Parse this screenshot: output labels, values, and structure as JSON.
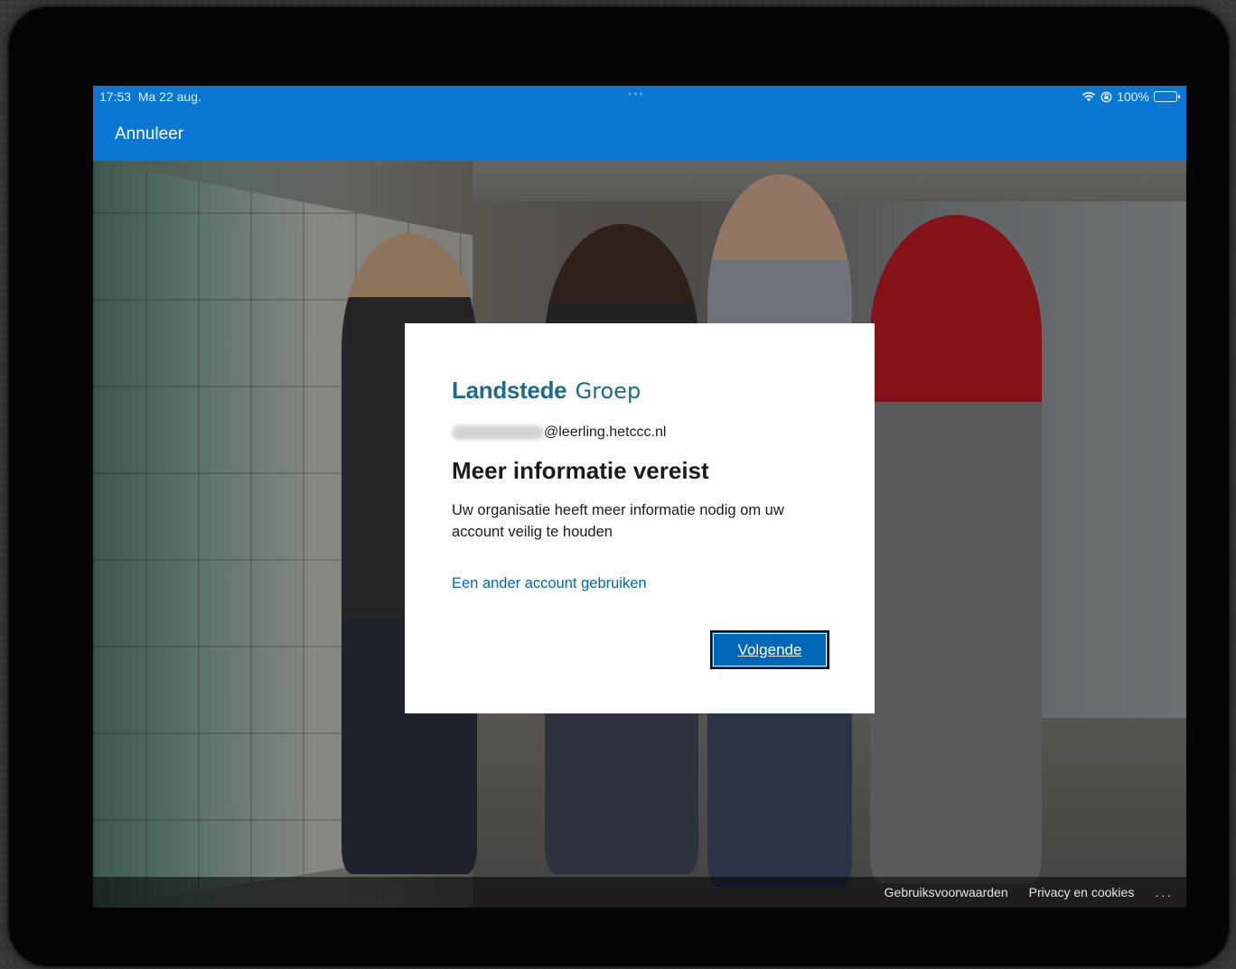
{
  "status_bar": {
    "time": "17:53",
    "date": "Ma 22 aug.",
    "multitask_dots": "•••",
    "wifi_icon": "wifi-icon",
    "lock_icon": "rotation-lock-icon",
    "battery": "100%"
  },
  "navbar": {
    "cancel_label": "Annuleer"
  },
  "dialog": {
    "brand_bold": "Landstede",
    "brand_light": "Groep",
    "account_suffix": "@leerling.hetccc.nl",
    "title": "Meer informatie vereist",
    "description": "Uw organisatie heeft meer informatie nodig om uw account veilig te houden",
    "alt_account_link": "Een ander account gebruiken",
    "next_button": "Volgende"
  },
  "footer": {
    "terms": "Gebruiksvoorwaarden",
    "privacy": "Privacy en cookies",
    "more": "..."
  },
  "colors": {
    "header_blue": "#0a78d2",
    "button_blue": "#0067b8",
    "brand_teal": "#1d6a8e"
  }
}
